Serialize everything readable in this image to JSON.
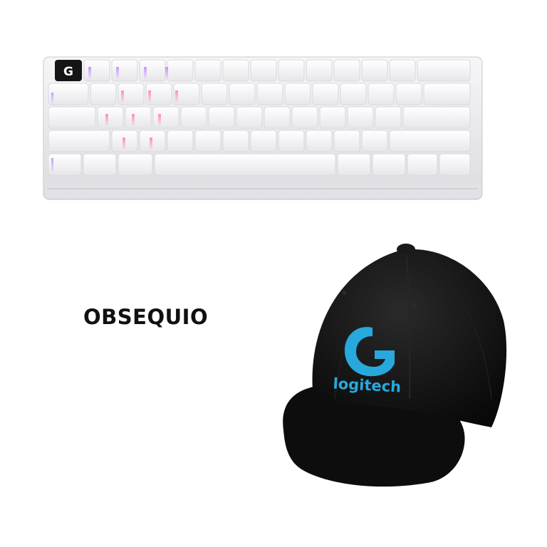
{
  "promo": {
    "label": "OBSEQUIO"
  },
  "keyboard": {
    "brand_icon": "logitech-g-icon",
    "body_color": "#e9e9ec",
    "keycap_color": "#f3f3f5",
    "backlight_colors": [
      "#ff4fa0",
      "#c56bff",
      "#7c7cff"
    ]
  },
  "cap": {
    "brand_icon": "logitech-g-icon",
    "embroidery_text": "logitech",
    "cap_color": "#121212",
    "embroidery_color": "#28a9de"
  }
}
